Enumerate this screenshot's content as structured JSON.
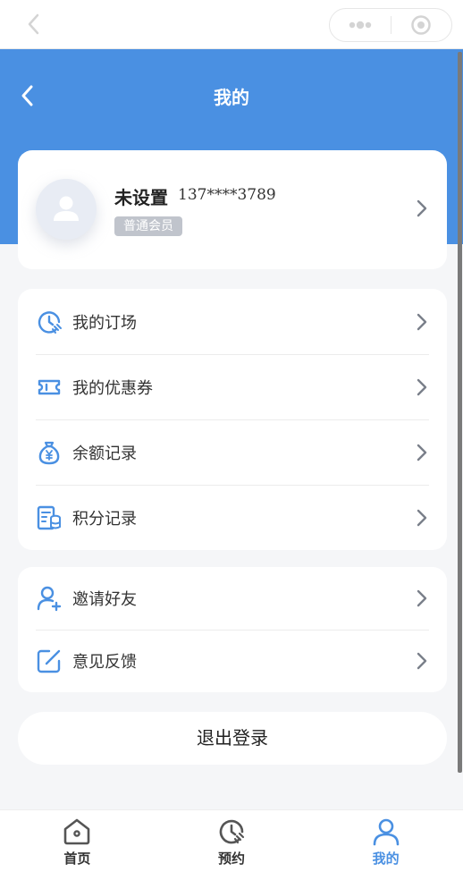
{
  "header": {
    "title": "我的"
  },
  "profile": {
    "nickname": "未设置",
    "phone": "137****3789",
    "member_level": "普通会员"
  },
  "menu_group_1": [
    {
      "label": "我的订场",
      "icon": "clock-icon"
    },
    {
      "label": "我的优惠券",
      "icon": "ticket-icon"
    },
    {
      "label": "余额记录",
      "icon": "money-bag-icon"
    },
    {
      "label": "积分记录",
      "icon": "points-record-icon"
    }
  ],
  "menu_group_2": [
    {
      "label": "邀请好友",
      "icon": "add-user-icon"
    },
    {
      "label": "意见反馈",
      "icon": "edit-icon"
    }
  ],
  "logout_label": "退出登录",
  "tabbar": {
    "items": [
      {
        "label": "首页",
        "icon": "home-icon",
        "active": false
      },
      {
        "label": "预约",
        "icon": "clock-icon",
        "active": false
      },
      {
        "label": "我的",
        "icon": "user-icon",
        "active": true
      }
    ]
  },
  "colors": {
    "primary": "#4a90e2",
    "background": "#f5f6f8",
    "badge": "#c0c4cc"
  }
}
